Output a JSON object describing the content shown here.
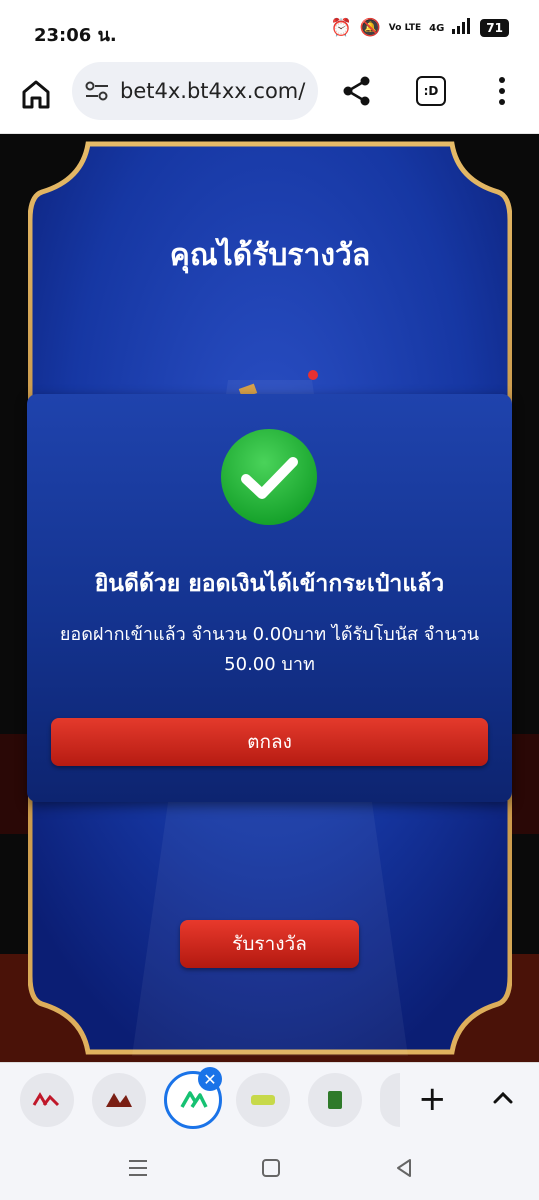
{
  "status_bar": {
    "time": "23:06 น.",
    "network": "4G",
    "volte": "Vo LTE",
    "battery": "71"
  },
  "browser": {
    "url": "bet4x.bt4xx.com/",
    "tab_switcher_label": ":D"
  },
  "page": {
    "reward_title": "คุณได้รับรางวัล",
    "claim_button": "รับรางวัล"
  },
  "dialog": {
    "title": "ยินดีด้วย ยอดเงินได้เข้ากระเป๋าแล้ว",
    "message": "ยอดฝากเข้าแล้ว จำนวน 0.00บาท ได้รับโบนัส จำนวน 50.00 บาท",
    "ok_button": "ตกลง"
  },
  "tab_strip": {
    "close_symbol": "✕",
    "new_tab_symbol": "+"
  },
  "colors": {
    "dialog_blue": "#1f43ad",
    "gold_frame": "#c99a4a",
    "button_red": "#d22b1f",
    "check_green": "#25b83a",
    "tab_accent": "#1a73e8"
  }
}
